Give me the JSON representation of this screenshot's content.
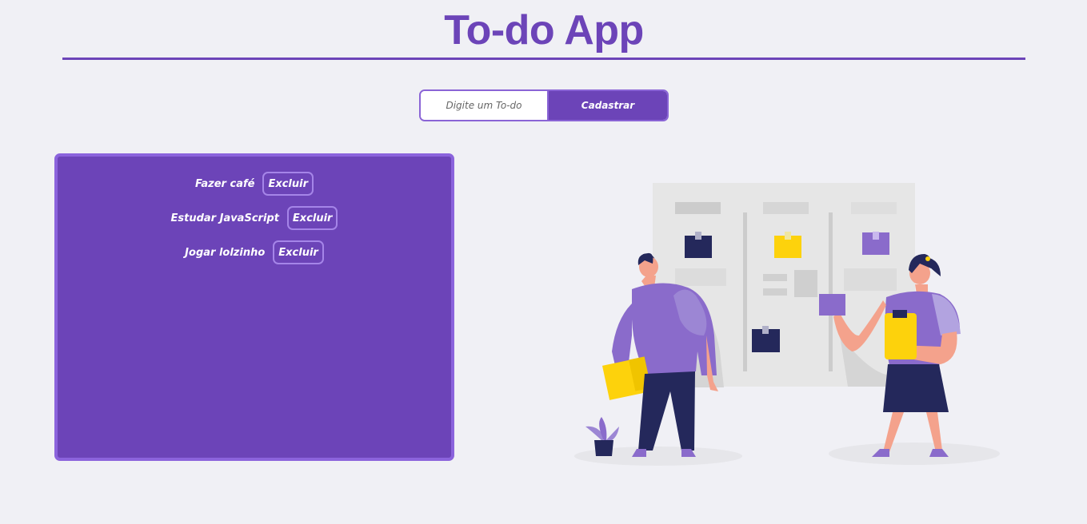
{
  "app": {
    "title": "To-do App"
  },
  "form": {
    "input_placeholder": "Digite um To-do",
    "input_value": "",
    "submit_label": "Cadastrar"
  },
  "todos": [
    {
      "text": "Fazer café",
      "delete_label": "Excluir"
    },
    {
      "text": "Estudar JavaScript",
      "delete_label": "Excluir"
    },
    {
      "text": "Jogar lolzinho",
      "delete_label": "Excluir"
    }
  ],
  "colors": {
    "accent": "#6c44b8",
    "accent_light": "#8b63dc",
    "background": "#f0f0f5",
    "illustration_yellow": "#fdd20c",
    "illustration_navy": "#24285b"
  }
}
